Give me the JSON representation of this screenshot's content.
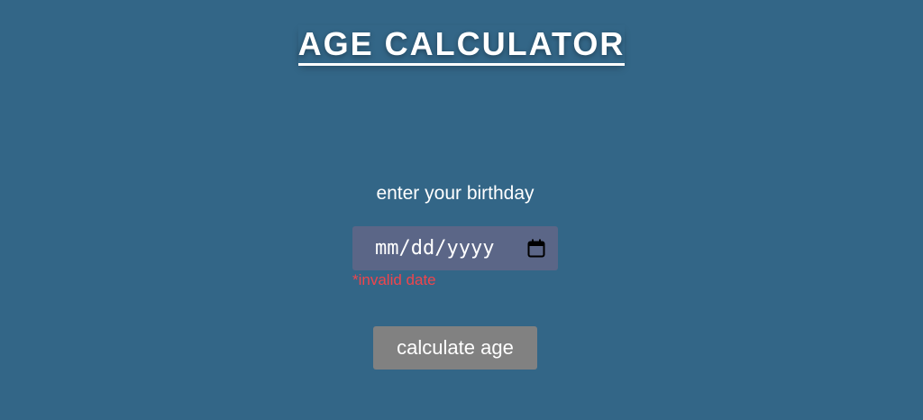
{
  "header": {
    "title": "AGE CALCULATOR"
  },
  "form": {
    "prompt": "enter your birthday",
    "date_input": {
      "placeholder": "mm/dd/yyyy",
      "value": "",
      "icon": "calendar-icon"
    },
    "error_message": "*invalid date",
    "submit_label": "calculate age"
  },
  "colors": {
    "background": "#336687",
    "input_background": "#5b6687",
    "error": "#f0454c",
    "button_background": "#818181",
    "text": "#ffffff"
  }
}
